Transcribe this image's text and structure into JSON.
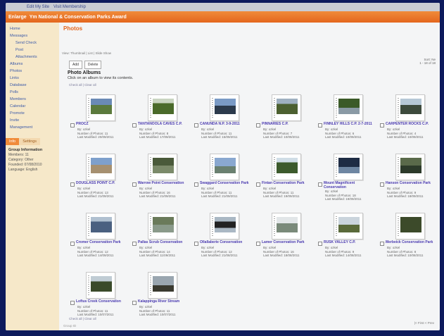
{
  "browser": {
    "strip_left": "Edit   My Site",
    "strip_right": "Visit Membership"
  },
  "app": {
    "brand": "Enlarge",
    "title": "Ym National & Conservation Parks Award"
  },
  "sidebar": {
    "items": [
      {
        "label": "Home",
        "sub": false
      },
      {
        "label": "Messages",
        "sub": false
      },
      {
        "label": "Send   Check",
        "sub": true
      },
      {
        "label": "Post",
        "sub": true
      },
      {
        "label": "Attachments",
        "sub": true
      },
      {
        "label": "Albums",
        "sub": false
      },
      {
        "label": "Photos",
        "sub": false
      },
      {
        "label": "Links",
        "sub": false
      },
      {
        "label": "Database",
        "sub": false
      },
      {
        "label": "Polls",
        "sub": false
      },
      {
        "label": "Members",
        "sub": false
      },
      {
        "label": "Calendar",
        "sub": false
      },
      {
        "label": "Promote",
        "sub": false
      },
      {
        "label": "Invite",
        "sub": false
      },
      {
        "label": "Management",
        "sub": false
      }
    ],
    "tabs": [
      "Info",
      "Settings"
    ],
    "group_info": {
      "title": "Group Information",
      "lines": [
        "Members: 11",
        "Category: Other",
        "Founded: 07/08/2010",
        "Language: English"
      ]
    }
  },
  "main": {
    "title": "Photos",
    "breadcrumb": "View: Thumbnail | List | Slide Show",
    "buttons": [
      "Add",
      "Delete"
    ],
    "sort_info": [
      "Sort: Ne",
      "1 - 18 of 18"
    ],
    "heading": "Photo Albums",
    "subheading": "Click on an album to view its contents.",
    "show_all_top": "Check all  |  Clear all",
    "show_all_bottom": "Check all  |  Clear all",
    "footer_right": "|< First  < Prev",
    "footer_left": "Group ID"
  },
  "albums": [
    {
      "title": "PROCZ",
      "lines": [
        "By: ozkel",
        "Number of Photos: 11",
        "Last Modified: 20/09/2011"
      ]
    },
    {
      "title": "TANTANOOLA CAVES C.P.",
      "lines": [
        "By: ozkel",
        "Number of Photos: 8",
        "Last Modified: 17/09/2011"
      ]
    },
    {
      "title": "CANUNDA N.P. 3-9-2011",
      "lines": [
        "By: ozkel",
        "Number of Photos: 11",
        "Last Modified: 15/09/2011"
      ]
    },
    {
      "title": "PINNARIES C.P.",
      "lines": [
        "By: ozkel",
        "Number of Photos: 7",
        "Last Modified: 10/09/2011"
      ]
    },
    {
      "title": "FINNLEY HILLS C.P. 2-7-2011",
      "lines": [
        "By: ozkel",
        "Number of Photos: 6",
        "Last Modified: 10/09/2011"
      ]
    },
    {
      "title": "CARPENTER ROCKS C.P.",
      "lines": [
        "By: ozkel",
        "Number of Photos: 4",
        "Last Modified: 10/09/2011"
      ]
    },
    {
      "title": "DOUGLASS POINT C.P.",
      "lines": [
        "By: ozkel",
        "Number of Photos: 13",
        "Last Modified: 21/09/2011"
      ]
    },
    {
      "title": "Warrow Point Conservation",
      "lines": [
        "By: ozkel",
        "Number of Photos: 16",
        "Last Modified: 21/09/2011"
      ]
    },
    {
      "title": "Swaggard Conservation Park",
      "lines": [
        "By: ozkel",
        "Number of Photos: 11",
        "Last Modified: 21/09/2011"
      ]
    },
    {
      "title": "Fintan Conservation Park",
      "lines": [
        "By: ozkel",
        "Number of Photos: 11",
        "Last Modified: 19/09/2011"
      ]
    },
    {
      "title": "Mount Magnificent Conservation",
      "lines": [
        "By: ozkel",
        "Number of Photos: 18",
        "Last Modified: 19/09/2011"
      ]
    },
    {
      "title": "Hanson Conservation Park",
      "lines": [
        "By: ozkel",
        "Number of Photos: 9",
        "Last Modified: 18/09/2011"
      ]
    },
    {
      "title": "Cromer Conservation Park",
      "lines": [
        "By: ozkel",
        "Number of Photos: 12",
        "Last Modified: 14/09/2011"
      ]
    },
    {
      "title": "Pallas Scrub Conservation",
      "lines": [
        "By: ozkel",
        "Number of Photos: 14",
        "Last Modified: 11/09/2011"
      ]
    },
    {
      "title": "Ollallaberie Conservation",
      "lines": [
        "By: ozkel",
        "Number of Photos: 12",
        "Last Modified: 21/08/2011"
      ]
    },
    {
      "title": "Lamer Conservation Park",
      "lines": [
        "By: ozkel",
        "Number of Photos: 16",
        "Last Modified: 18/08/2011"
      ]
    },
    {
      "title": "RUSK VALLEY C.P.",
      "lines": [
        "By: ozkel",
        "Number of Photos: 9",
        "Last Modified: 14/08/2011"
      ]
    },
    {
      "title": "Merbeick Conservation Park",
      "lines": [
        "By: ozkel",
        "Number of Photos: 8",
        "Last Modified: 10/08/2011"
      ]
    },
    {
      "title": "Loftus Creek Conservation",
      "lines": [
        "By: ozkel",
        "Number of Photos: 11",
        "Last Modified: 10/07/2011"
      ]
    },
    {
      "title": "Kalappinga River Stream",
      "lines": [
        "By: ozkel",
        "Number of Photos: 11",
        "Last Modified: 10/07/2011"
      ]
    }
  ]
}
